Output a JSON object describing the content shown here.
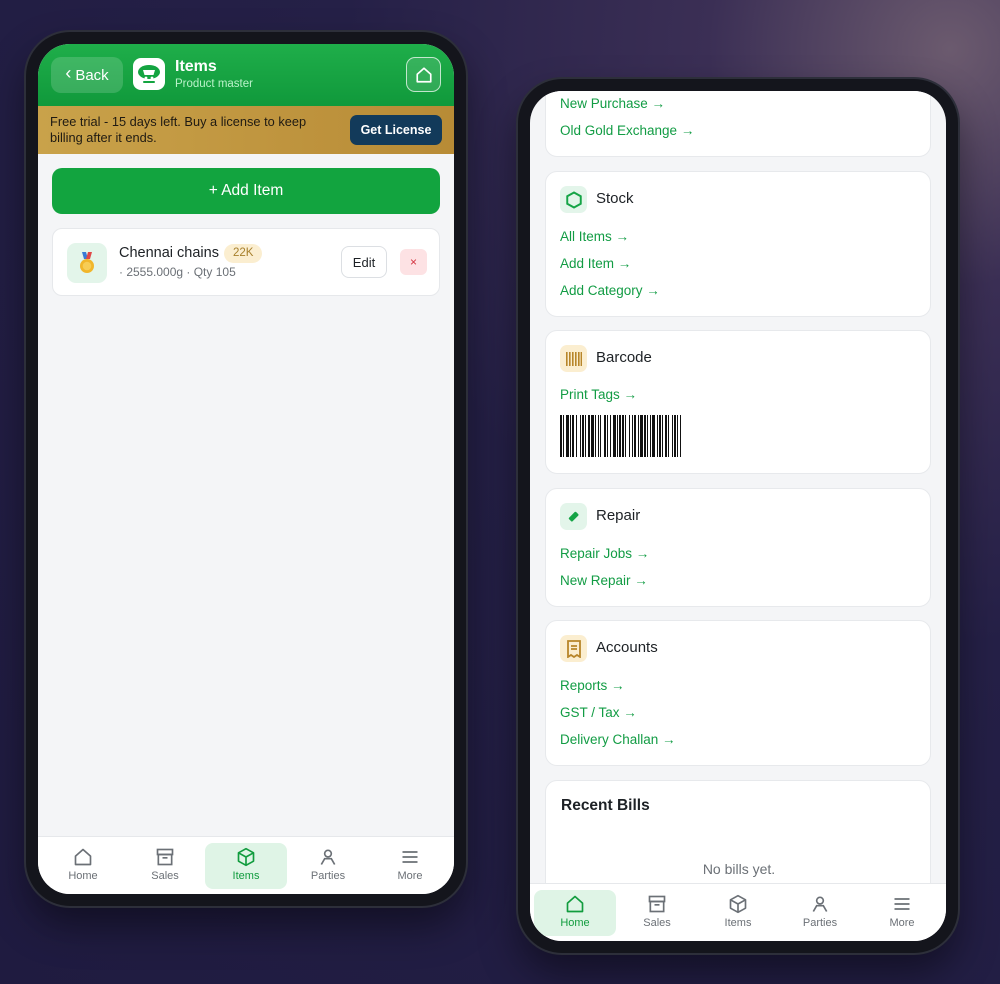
{
  "left": {
    "header": {
      "back_label": "Back",
      "title": "Items",
      "subtitle": "Product master"
    },
    "trial": {
      "message": "Free trial - 15 days left. Buy a license to keep billing after it ends.",
      "button_label": "Get License"
    },
    "add_item_label": "+ Add Item",
    "items": [
      {
        "name": "Chennai chains",
        "karat": "22K",
        "meta": "· 2555.000g · Qty 105",
        "edit_label": "Edit",
        "delete_label": "×"
      }
    ],
    "nav": [
      {
        "label": "Home",
        "icon": "home-icon"
      },
      {
        "label": "Sales",
        "icon": "sales-icon"
      },
      {
        "label": "Items",
        "icon": "box-icon",
        "active": true
      },
      {
        "label": "Parties",
        "icon": "person-icon"
      },
      {
        "label": "More",
        "icon": "menu-icon"
      }
    ]
  },
  "right": {
    "purchase_links": [
      "New Purchase →",
      "Old Gold Exchange →"
    ],
    "stock": {
      "title": "Stock",
      "links": [
        "All Items →",
        "Add Item →",
        "Add Category →"
      ]
    },
    "barcode": {
      "title": "Barcode",
      "links": [
        "Print Tags →"
      ]
    },
    "repair": {
      "title": "Repair",
      "links": [
        "Repair Jobs →",
        "New Repair →"
      ]
    },
    "accounts": {
      "title": "Accounts",
      "links": [
        "Reports →",
        "GST / Tax →",
        "Delivery Challan →"
      ]
    },
    "recent_bills": {
      "title": "Recent Bills",
      "empty": "No bills yet."
    },
    "nav": [
      {
        "label": "Home",
        "icon": "home-icon",
        "active": true
      },
      {
        "label": "Sales",
        "icon": "sales-icon"
      },
      {
        "label": "Items",
        "icon": "box-icon"
      },
      {
        "label": "Parties",
        "icon": "person-icon"
      },
      {
        "label": "More",
        "icon": "menu-icon"
      }
    ]
  },
  "colors": {
    "brand_green": "#12a43f",
    "link_green": "#129c44",
    "trial_gold": "#c9a24a",
    "license_navy": "#123a5a",
    "danger": "#d3323f"
  }
}
